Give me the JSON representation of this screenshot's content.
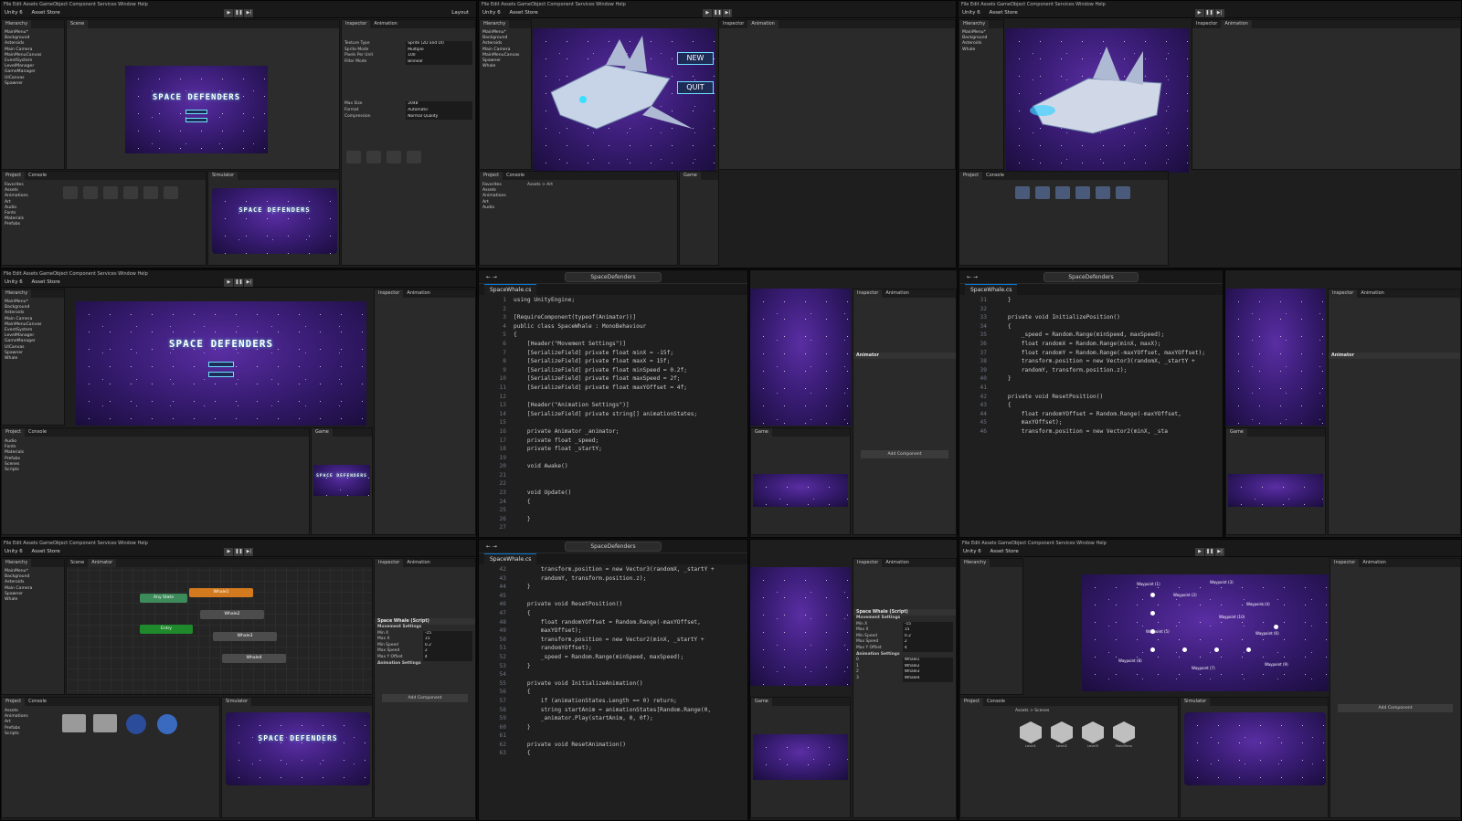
{
  "app": {
    "unity_label": "Unity 6",
    "menu": "File  Edit  Assets  GameObject  Component  Services  Window  Help",
    "asset_store": "Asset Store",
    "layout": "Layout"
  },
  "tabs": {
    "hierarchy": "Hierarchy",
    "scene": "Scene",
    "game": "Game",
    "inspector": "Inspector",
    "animation": "Animation",
    "animator": "Animator",
    "project": "Project",
    "console": "Console",
    "simulator": "Simulator"
  },
  "hierarchy_items": [
    "MainMenu*",
    "Background",
    "Asteroids",
    "Main Camera",
    "MainMenuCanvas",
    "EventSystem",
    "LevelManager",
    "GameManager",
    "UICanvas",
    "Spawner",
    "Whale"
  ],
  "game": {
    "title": "SPACE DEFENDERS",
    "button_new": "NEW",
    "button_quit": "QUIT"
  },
  "project_folders": [
    "Favorites",
    "Assets",
    "Animations",
    "Art",
    "Audio",
    "Fonts",
    "Materials",
    "Prefabs",
    "Scenes",
    "Scripts",
    "Sprites"
  ],
  "project_path": "Assets > Art",
  "inspector_top": {
    "rows": [
      {
        "label": "Texture Type",
        "value": "Sprite (2D and UI)"
      },
      {
        "label": "Sprite Mode",
        "value": "Multiple"
      },
      {
        "label": "Pixels Per Unit",
        "value": "100"
      },
      {
        "label": "Filter Mode",
        "value": "Bilinear"
      },
      {
        "label": "Max Size",
        "value": "2048"
      },
      {
        "label": "Format",
        "value": "Automatic"
      },
      {
        "label": "Compression",
        "value": "Normal Quality"
      }
    ]
  },
  "editor": {
    "search": "SpaceDefenders",
    "tab": "SpaceWhale.cs"
  },
  "code1": {
    "line_numbers": [
      1,
      2,
      3,
      4,
      5,
      6,
      7,
      8,
      9,
      10,
      11,
      12,
      13,
      14,
      15,
      16,
      17,
      18,
      19,
      20,
      21,
      22,
      23,
      24,
      25,
      26,
      27
    ],
    "lines": [
      "using UnityEngine;",
      "",
      "[RequireComponent(typeof(Animator))]",
      "public class SpaceWhale : MonoBehaviour",
      "{",
      "    [Header(\"Movement Settings\")]",
      "    [SerializeField] private float minX = -15f;",
      "    [SerializeField] private float maxX = 15f;",
      "    [SerializeField] private float minSpeed = 0.2f;",
      "    [SerializeField] private float maxSpeed = 2f;",
      "    [SerializeField] private float maxYOffset = 4f;",
      "",
      "    [Header(\"Animation Settings\")]",
      "    [SerializeField] private string[] animationStates;",
      "",
      "    private Animator _animator;",
      "    private float _speed;",
      "    private float _startY;",
      "",
      "    void Awake()",
      "",
      "",
      "    void Update()",
      "    {",
      "",
      "    }",
      ""
    ]
  },
  "code2": {
    "line_numbers": [
      31,
      32,
      33,
      34,
      35,
      36,
      37,
      38,
      39,
      40,
      41,
      42,
      43,
      44,
      45,
      46
    ],
    "lines": [
      "    }",
      "",
      "    private void InitializePosition()",
      "    {",
      "        _speed = Random.Range(minSpeed, maxSpeed);",
      "        float randomX = Random.Range(minX, maxX);",
      "        float randomY = Random.Range(-maxYOffset, maxYOffset);",
      "        transform.position = new Vector3(randomX, _startY +",
      "        randomY, transform.position.z);",
      "    }",
      "",
      "    private void ResetPosition()",
      "    {",
      "        float randomYOffset = Random.Range(-maxYOffset,",
      "        maxYOffset);",
      "        transform.position = new Vector2(minX, _sta"
    ]
  },
  "code3": {
    "line_numbers": [
      42,
      43,
      44,
      45,
      46,
      47,
      48,
      49,
      50,
      51,
      52,
      53,
      54,
      55,
      56,
      57,
      58,
      59,
      60,
      61,
      62,
      63
    ],
    "lines": [
      "        transform.position = new Vector3(randomX, _startY +",
      "        randomY, transform.position.z);",
      "    }",
      "",
      "    private void ResetPosition()",
      "    {",
      "        float randomYOffset = Random.Range(-maxYOffset,",
      "        maxYOffset);",
      "        transform.position = new Vector2(minX, _startY +",
      "        randomYOffset);",
      "        _speed = Random.Range(minSpeed, maxSpeed);",
      "    }",
      "",
      "    private void InitializeAnimation()",
      "    {",
      "        if (animationStates.Length == 0) return;",
      "        string startAnim = animationStates[Random.Range(0,",
      "        _animator.Play(startAnim, 0, 0f);",
      "    }",
      "",
      "    private void ResetAnimation()",
      "    {"
    ]
  },
  "animator_nodes": [
    "Any State",
    "Whale1",
    "Whale2",
    "Whale3",
    "Whale4",
    "Entry"
  ],
  "whale_inspector": {
    "header": "Space Whale (Script)",
    "movement_header": "Movement Settings",
    "rows": [
      {
        "label": "Min X",
        "value": "-15"
      },
      {
        "label": "Max X",
        "value": "15"
      },
      {
        "label": "Min Speed",
        "value": "0.2"
      },
      {
        "label": "Max Speed",
        "value": "2"
      },
      {
        "label": "Max Y Offset",
        "value": "4"
      }
    ],
    "animation_header": "Animation Settings",
    "states": [
      "Whale1",
      "Whale2",
      "Whale3",
      "Whale4"
    ]
  },
  "waypoints": [
    "Waypoint (1)",
    "Waypoint (2)",
    "Waypoint (3)",
    "Waypoint (4)",
    "Waypoint (5)",
    "Waypoint (6)",
    "Waypoint (7)",
    "Waypoint (8)",
    "Waypoint (9)",
    "Waypoint (10)"
  ],
  "scenes_folder": {
    "path": "Assets > Scenes",
    "items": [
      "Level1",
      "Level2",
      "Level3",
      "MainMenu"
    ]
  },
  "add_component": "Add Component",
  "colors": {
    "editor_bg": "#1e1e1e",
    "accent": "#0078d4",
    "space_purple": "#3a1d76",
    "neon_cyan": "#6ee0ff"
  }
}
